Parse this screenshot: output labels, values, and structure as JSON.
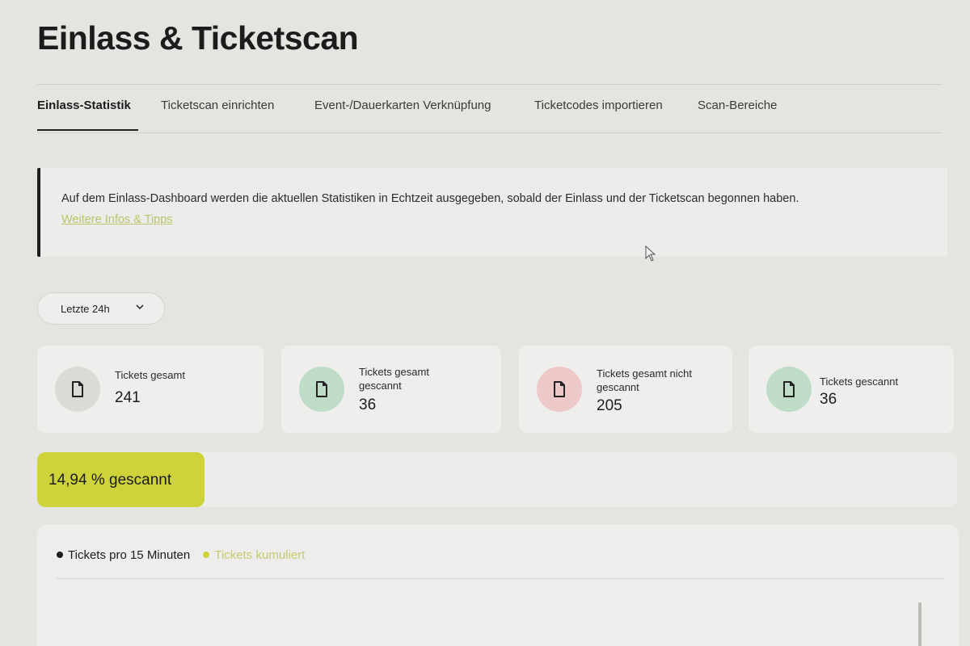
{
  "header": {
    "title": "Einlass & Ticketscan"
  },
  "tabs": [
    {
      "label": "Einlass-Statistik",
      "active": true
    },
    {
      "label": "Ticketscan einrichten"
    },
    {
      "label": "Event-/Dauerkarten Verknüpfung"
    },
    {
      "label": "Ticketcodes importieren"
    },
    {
      "label": "Scan-Bereiche"
    }
  ],
  "info": {
    "text": "Auf dem Einlass-Dashboard werden die aktuellen Statistiken in Echtzeit ausgegeben, sobald der Einlass und der Ticketscan begonnen haben.",
    "link": "Weitere Infos & Tipps"
  },
  "filter": {
    "label": "Letzte 24h",
    "icon": "chevron-down-icon"
  },
  "stats": [
    {
      "label": "Tickets gesamt",
      "value": "241",
      "icon": "document-icon",
      "color": "#dadad7"
    },
    {
      "label": "Tickets gesamt gescannt",
      "value": "36",
      "icon": "document-icon",
      "color": "#bfdcc9"
    },
    {
      "label": "Tickets gesamt nicht gescannt",
      "value": "205",
      "icon": "document-icon",
      "color": "#edc9c9"
    },
    {
      "label": "Tickets gescannt",
      "value": "36",
      "icon": "document-icon",
      "color": "#bfdcc9"
    }
  ],
  "progress": {
    "label": "14,94 % gescannt",
    "fraction": 0.1494,
    "color": "#cfd33a"
  },
  "chart": {
    "legend": [
      {
        "label": "Tickets pro 15 Minuten",
        "color": "#1c1c1c"
      },
      {
        "label": "Tickets kumuliert",
        "color": "#cfd33a"
      }
    ]
  }
}
